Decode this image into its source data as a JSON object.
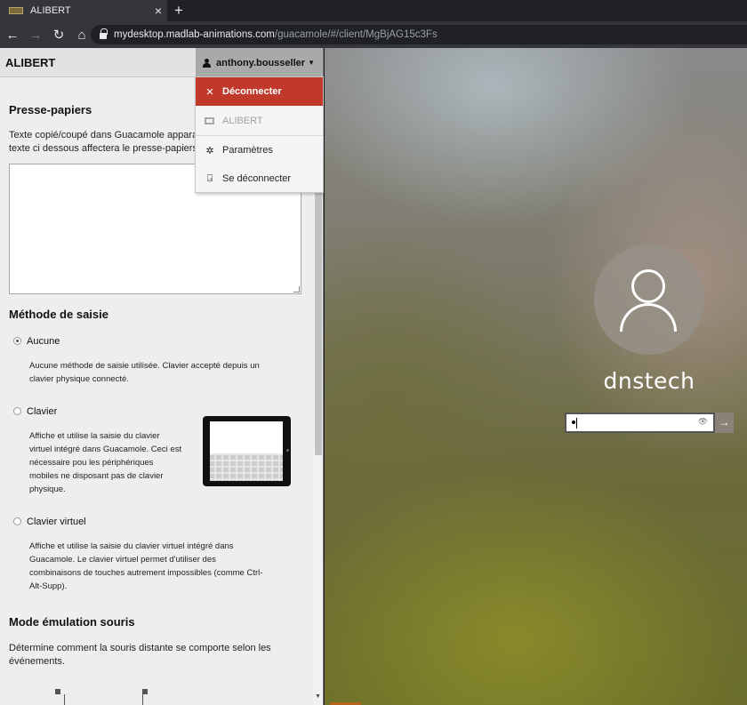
{
  "browser": {
    "tab_title": "ALIBERT",
    "tab_close": "×",
    "new_tab": "+",
    "url_host": "mydesktop.madlab-animations.com",
    "url_path": "/guacamole/#/client/MgBjAG15c3Fs"
  },
  "panel": {
    "connection_name": "ALIBERT",
    "user": "anthony.bousseller",
    "clipboard": {
      "title": "Presse-papiers",
      "desc_line1": "Texte copié/coupé dans Guacamole apparaî",
      "desc_line2": "texte ci dessous affectera le presse-papiers"
    },
    "input_method": {
      "title": "Méthode de saisie",
      "options": [
        {
          "label": "Aucune",
          "selected": true,
          "desc": [
            "Aucune méthode de saisie utilisée. Clavier accepté depuis un",
            "clavier physique connecté."
          ]
        },
        {
          "label": "Clavier",
          "selected": false,
          "desc": [
            "Affiche et utilise la saisie du clavier",
            "virtuel intégré dans Guacamole. Ceci est",
            "nécessaire pou les périphériques",
            "mobiles ne disposant pas de clavier",
            "physique."
          ]
        },
        {
          "label": "Clavier virtuel",
          "selected": false,
          "desc": [
            "Affiche et utilise la saisie du clavier virtuel intégré dans",
            "Guacamole. Le clavier virtuel permet d'utiliser des",
            "combinaisons de touches autrement impossibles (comme Ctrl-",
            "Alt-Supp)."
          ]
        }
      ]
    },
    "mouse_mode": {
      "title": "Mode émulation souris",
      "desc_line1": "Détermine comment la souris distante se comporte selon les",
      "desc_line2": "événements."
    }
  },
  "menu": {
    "items": [
      {
        "label": "Déconnecter",
        "icon": "close-icon",
        "state": "active"
      },
      {
        "label": "ALIBERT",
        "icon": "monitor-icon",
        "state": "disabled"
      },
      {
        "label": "Paramètres",
        "icon": "gear-icon",
        "state": "normal"
      },
      {
        "label": "Se déconnecter",
        "icon": "logout-icon",
        "state": "normal"
      }
    ]
  },
  "remote": {
    "username": "dnstech"
  },
  "colors": {
    "accent": "#c0392b",
    "panel_bg": "#eeeeee",
    "user_menu_bg": "#a9a9a9"
  }
}
